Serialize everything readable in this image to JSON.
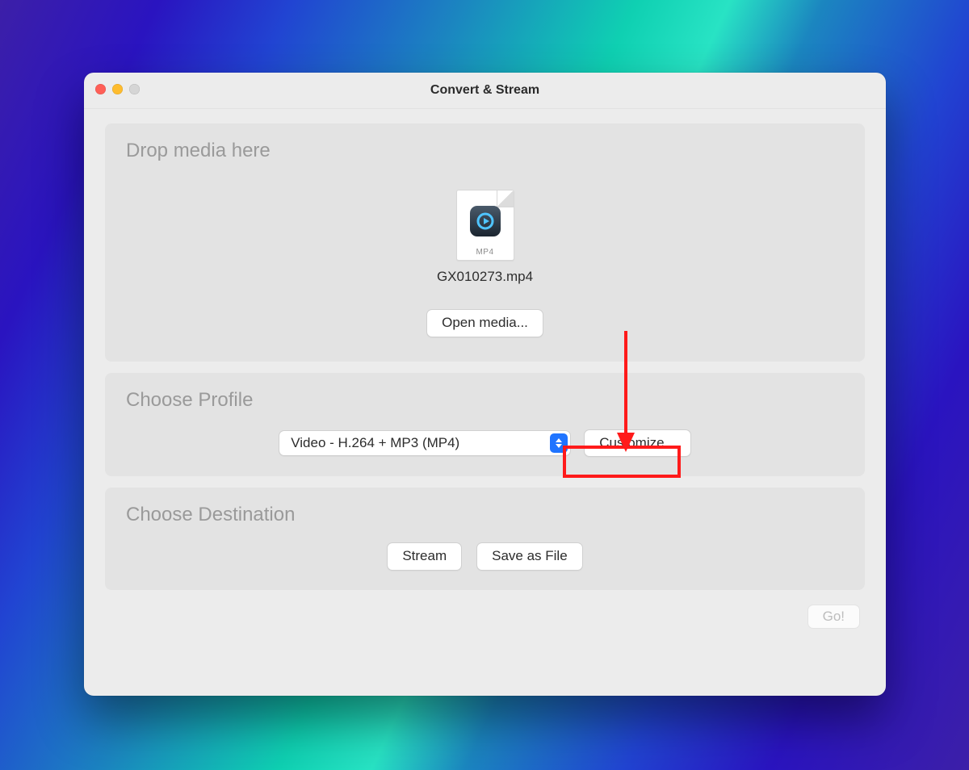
{
  "window": {
    "title": "Convert & Stream"
  },
  "drop": {
    "heading": "Drop media here",
    "file_badge": "MP4",
    "filename": "GX010273.mp4",
    "open_button": "Open media..."
  },
  "profile": {
    "heading": "Choose Profile",
    "selected": "Video - H.264 + MP3 (MP4)",
    "customize_button": "Customize..."
  },
  "destination": {
    "heading": "Choose Destination",
    "stream_button": "Stream",
    "save_button": "Save as File"
  },
  "footer": {
    "go_button": "Go!"
  }
}
